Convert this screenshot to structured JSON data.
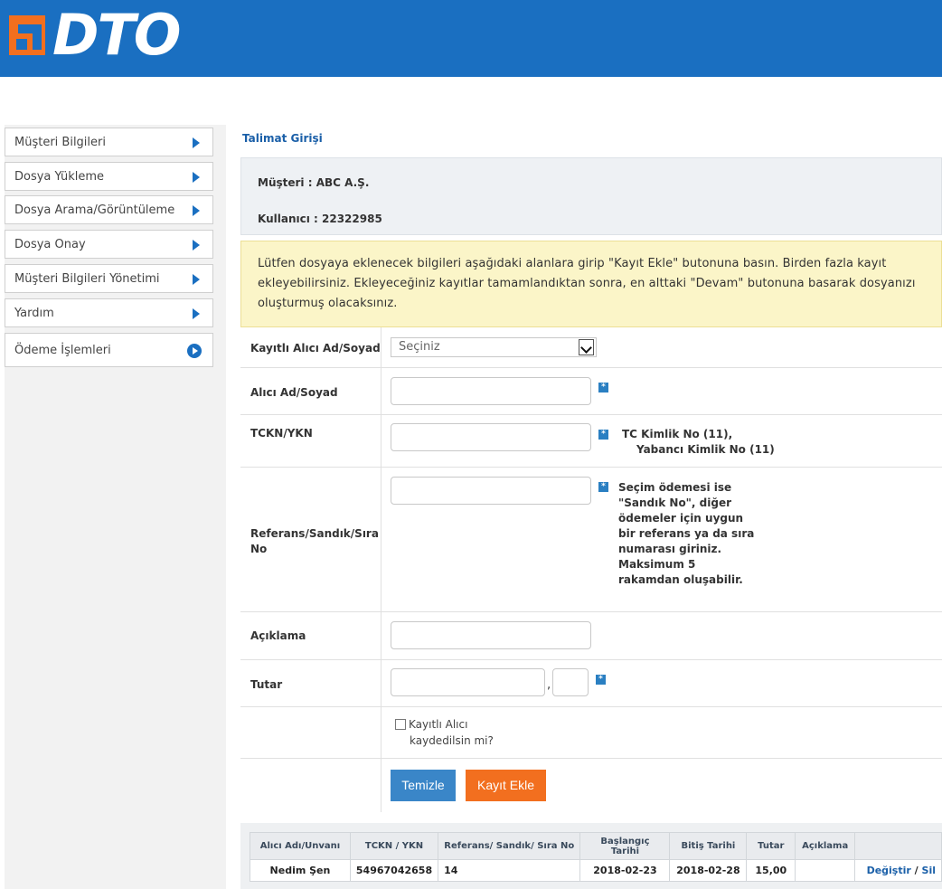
{
  "header": {
    "logo_text": "DTO",
    "brand_color": "#1a6fc1"
  },
  "sidebar": {
    "items": [
      {
        "label": "Müşteri Bilgileri"
      },
      {
        "label": "Dosya Yükleme"
      },
      {
        "label": "Dosya Arama/Görüntüleme"
      },
      {
        "label": "Dosya Onay"
      },
      {
        "label": "Müşteri Bilgileri Yönetimi"
      },
      {
        "label": "Yardım"
      },
      {
        "label": "Ödeme İşlemleri"
      }
    ]
  },
  "page": {
    "title": "Talimat Girişi",
    "customer_line": "Müşteri :  ABC A.Ş.",
    "user_line": "Kullanıcı : 22322985",
    "info_text": "Lütfen dosyaya eklenecek bilgileri aşağıdaki alanlara girip \"Kayıt Ekle\" butonuna basın. Birden fazla kayıt ekleyebilirsiniz. Ekleyeceğiniz kayıtlar tamamlandıktan sonra, en alttaki \"Devam\" butonuna basarak dosyanızı oluşturmuş olacaksınız."
  },
  "form": {
    "saved_recipient_label": "Kayıtlı Alıcı Ad/Soyad",
    "saved_recipient_value": "Seçiniz",
    "recipient_label": "Alıcı Ad/Soyad",
    "tckn_label": "TCKN/YKN",
    "tckn_hint_1": "TC Kimlik No (11),",
    "tckn_hint_2": "Yabancı Kimlik No (11)",
    "reference_label_1": "Referans/Sandık/Sıra",
    "reference_label_2": "No",
    "reference_hint": [
      "Seçim ödemesi ise",
      "\"Sandık No\", diğer",
      "ödemeler için uygun",
      "bir referans ya da sıra",
      "numarası giriniz.",
      "Maksimum 5",
      "rakamdan oluşabilir."
    ],
    "description_label": "Açıklama",
    "amount_label": "Tutar",
    "amount_separator": ",",
    "save_recipient_label_1": "Kayıtlı Alıcı",
    "save_recipient_label_2": "kaydedilsin mi?",
    "clear_button": "Temizle",
    "add_button": "Kayıt Ekle",
    "required_marker": "*"
  },
  "table": {
    "headers": [
      "Alıcı Adı/Unvanı",
      "TCKN / YKN",
      "Referans/ Sandık/ Sıra No",
      "Başlangıç Tarihi",
      "Bitiş Tarihi",
      "Tutar",
      "Açıklama",
      ""
    ],
    "rows": [
      {
        "name": "Nedim Şen",
        "tckn": "54967042658",
        "ref": "14",
        "start": "2018-02-23",
        "end": "2018-02-28",
        "amount": "15,00",
        "desc": "",
        "edit": "Değiştir",
        "sep": "/",
        "delete": "Sil"
      }
    ]
  }
}
